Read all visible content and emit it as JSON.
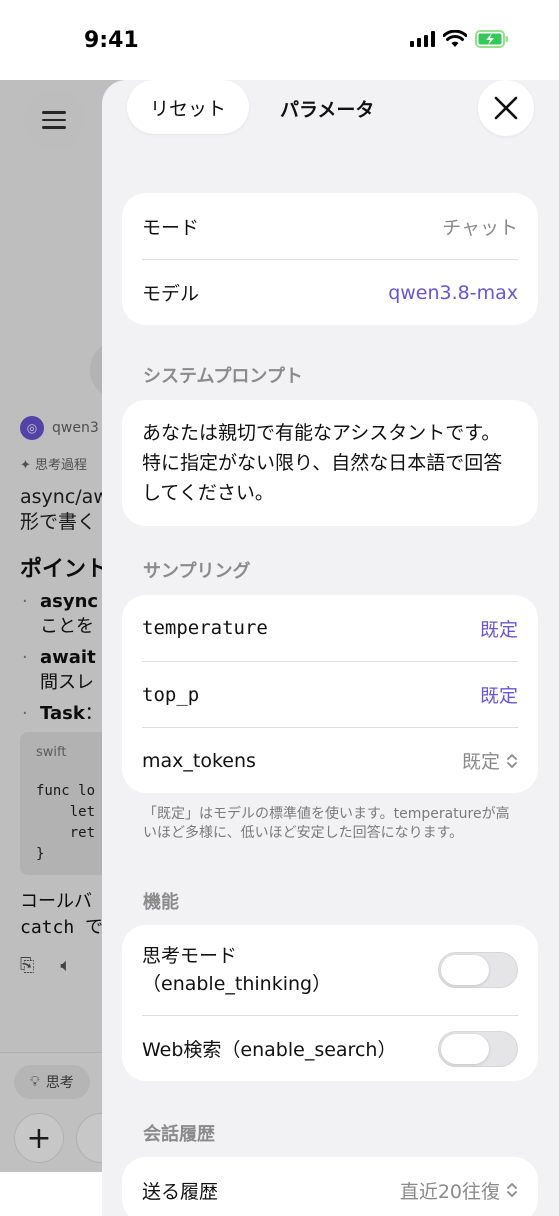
{
  "status": {
    "time": "9:41"
  },
  "background": {
    "model_name": "qwen3",
    "thinking_label": "思考過程",
    "paragraph": "async/aw\n形で書く",
    "heading": "ポイント",
    "bullets": [
      {
        "bold": "async",
        "rest": "",
        "line2": "ことを"
      },
      {
        "bold": "await",
        "rest": "",
        "line2": "間スレ"
      },
      {
        "bold": "Task",
        "rest": "：",
        "line2": ""
      }
    ],
    "code_lang": "swift",
    "code_lines": [
      "func lo",
      "    let",
      "    ret",
      "}"
    ],
    "paragraph2_line1": "コールバ",
    "paragraph2_line2": "catch で",
    "chip_label": "思考"
  },
  "sheet": {
    "reset_label": "リセット",
    "title": "パラメータ",
    "mode": {
      "label": "モード",
      "value": "チャット"
    },
    "model": {
      "label": "モデル",
      "value": "qwen3.8-max"
    },
    "system_prompt_section": "システムプロンプト",
    "system_prompt": "あなたは親切で有能なアシスタントです。特に指定がない限り、自然な日本語で回答してください。",
    "sampling_section": "サンプリング",
    "sampling": [
      {
        "label": "temperature",
        "value": "既定"
      },
      {
        "label": "top_p",
        "value": "既定"
      },
      {
        "label": "max_tokens",
        "value": "既定"
      }
    ],
    "sampling_note": "「既定」はモデルの標準値を使います。temperatureが高いほど多様に、低いほど安定した回答になります。",
    "features_section": "機能",
    "features": [
      {
        "label_line1": "思考モード",
        "label_line2": "（enable_thinking）",
        "on": false
      },
      {
        "label": "Web検索（enable_search）",
        "on": false
      }
    ],
    "history_section": "会話履歴",
    "history": {
      "label": "送る履歴",
      "value": "直近20往復"
    }
  },
  "colors": {
    "accent": "#6a55cf",
    "sheet_bg": "#f2f2f4"
  }
}
